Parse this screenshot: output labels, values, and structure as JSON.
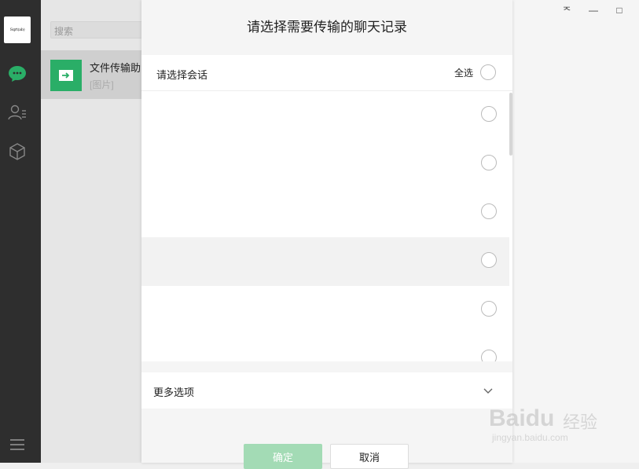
{
  "nav": {
    "avatar_text": "Sqrt(ab)"
  },
  "chatlist": {
    "search_placeholder": "搜索",
    "items": [
      {
        "name": "文件传输助",
        "preview": "[图片]"
      }
    ]
  },
  "window": {
    "pin": "ᅐ",
    "minimize": "—",
    "maximize": "□"
  },
  "dialog": {
    "title": "请选择需要传输的聊天记录",
    "select_conversation_label": "请选择会话",
    "select_all_label": "全选",
    "more_options_label": "更多选项",
    "confirm_label": "确定",
    "cancel_label": "取消",
    "rows": [
      {
        "name": ""
      },
      {
        "name": ""
      },
      {
        "name": ""
      },
      {
        "name": ""
      },
      {
        "name": ""
      },
      {
        "name": ""
      }
    ]
  },
  "watermark": {
    "brand": "Baidu",
    "brand_cn": "经验",
    "url": "jingyan.baidu.com"
  },
  "colors": {
    "accent_green": "#2aae67",
    "confirm_disabled": "#a3dbb5",
    "nav_bg": "#2e2e2e"
  }
}
